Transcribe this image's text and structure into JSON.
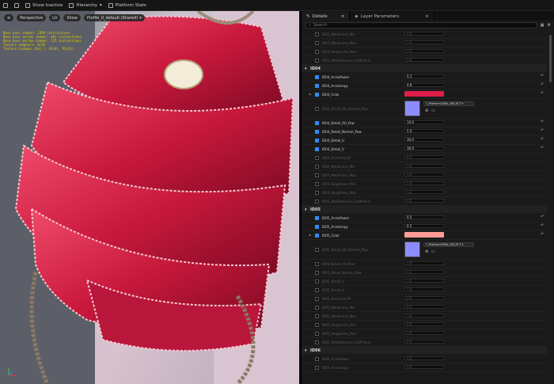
{
  "topbar": {
    "show_inactive": "Show Inactive",
    "hierarchy": "Hierarchy",
    "platform_stats": "Platform Stats"
  },
  "viewport": {
    "perspective": "Perspective",
    "lit": "Lit",
    "show": "Show",
    "profile": "Profile_0_default (Shared)",
    "stats": [
      "Base pass shader: 1269 instructions",
      "Base pass vertex shader: 461 instructions",
      "Base pass vertex shader: 525 instructions",
      "Texture samplers: 8/16",
      "Texture Lookups (Est.): VS(0), PS(33)"
    ]
  },
  "panel": {
    "details_tab": "Details",
    "layer_tab": "Layer Parameters",
    "search_placeholder": "Search"
  },
  "rows": [
    {
      "name": "ID03_Metallness_Min",
      "val": "0.0",
      "dis": true
    },
    {
      "name": "ID03_Metallness_Max",
      "val": "1.0",
      "dis": true
    },
    {
      "name": "ID03_Roughness_Max",
      "val": "1.0",
      "dis": true
    },
    {
      "name": "ID03_WetDarkness Coefficient",
      "val": "0.0",
      "dis": true
    },
    {
      "group": "ID04"
    },
    {
      "name": "ID04_AnisoPower",
      "val": "0.1",
      "on": true
    },
    {
      "name": "ID04_Anisotropy",
      "val": "0.8",
      "on": true
    },
    {
      "name": "ID04_Color",
      "swatch": "#e01c48",
      "on": true
    },
    {
      "name": "ID04_Detail_AO_Normal_Map",
      "tex": "T_PlatformCRBA_DM_RCT",
      "dis": true
    },
    {
      "name": "ID04_Detail_AO_Pow",
      "val": "10.0",
      "on": true
    },
    {
      "name": "ID04_Detail_Normal_Pow",
      "val": "5.0",
      "on": true
    },
    {
      "name": "ID04_Detail_U",
      "val": "30.0",
      "on": true
    },
    {
      "name": "ID04_Detail_V",
      "val": "30.0",
      "on": true
    },
    {
      "name": "ID04_DustColor3P",
      "val": "0.0",
      "dis": true
    },
    {
      "name": "ID04_Metallness_Min",
      "val": "0.0",
      "dis": true
    },
    {
      "name": "ID04_Metallness_Max",
      "val": "1.0",
      "dis": true
    },
    {
      "name": "ID04_Roughness_Min",
      "val": "1.0",
      "dis": true
    },
    {
      "name": "ID04_Roughness_Max",
      "val": "1.0",
      "dis": true
    },
    {
      "name": "ID04_WetDarkness Coefficient",
      "val": "0.0",
      "dis": true
    },
    {
      "group": "ID05"
    },
    {
      "name": "ID05_AnisoPower",
      "val": "0.5",
      "on": true
    },
    {
      "name": "ID05_Anisotropy",
      "val": "0.5",
      "on": true
    },
    {
      "name": "ID05_Color",
      "swatch": "#ff9c96",
      "on": true
    },
    {
      "name": "ID05_Detail_AO_Normal_Map",
      "tex": "T_PlatformCRBA_DM_RCT",
      "dis": true
    },
    {
      "name": "ID05_Detail_AO_Pow",
      "val": "1.0",
      "dis": true
    },
    {
      "name": "ID05_Detail_Normal_Pow",
      "val": "1.0",
      "dis": true
    },
    {
      "name": "ID05_Detail_U",
      "val": "1.0",
      "dis": true
    },
    {
      "name": "ID05_Detail_V",
      "val": "1.0",
      "dis": true
    },
    {
      "name": "ID05_DustColor3P",
      "val": "0.0",
      "dis": true
    },
    {
      "name": "ID05_Metallness_Min",
      "val": "0.0",
      "dis": true
    },
    {
      "name": "ID05_Metallness_Max",
      "val": "1.0",
      "dis": true
    },
    {
      "name": "ID05_Roughness_Min",
      "val": "0.0",
      "dis": true
    },
    {
      "name": "ID05_Roughness_Max",
      "val": "1.0",
      "dis": true
    },
    {
      "name": "ID05_WetDarkness Coefficient",
      "val": "0.0",
      "dis": true
    },
    {
      "group": "ID06"
    },
    {
      "name": "ID06_AnisoPower",
      "val": "0.0",
      "dis": true
    },
    {
      "name": "ID06_Anisotropy",
      "val": "0.0",
      "dis": true
    }
  ],
  "colors": {
    "accent": "#2d8cf0",
    "id04_color": "#e01c48",
    "id05_color": "#ff9c96"
  }
}
